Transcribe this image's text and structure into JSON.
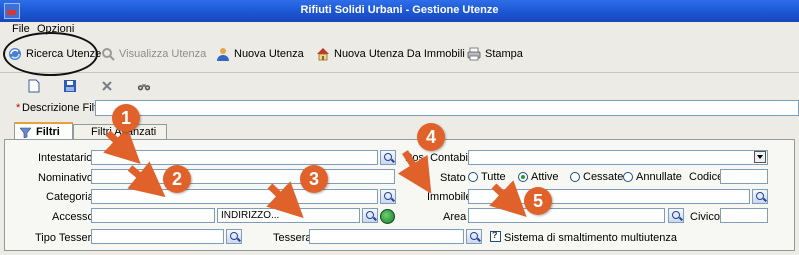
{
  "window": {
    "title": "Rifiuti Solidi Urbani - Gestione Utenze"
  },
  "menu": {
    "items": [
      "File",
      "Opzioni"
    ]
  },
  "toolbar": {
    "ricerca": "Ricerca Utenze",
    "visualizza": "Visualizza Utenza",
    "nuova": "Nuova Utenza",
    "nuova_immobili": "Nuova Utenza Da Immobili",
    "stampa": "Stampa"
  },
  "filter": {
    "descrizione_label": "Descrizione Filtro",
    "descrizione_required_mark": "*",
    "descrizione_value": ""
  },
  "tabs": [
    {
      "label": "Filtri"
    },
    {
      "label": "Filtri Avanzati"
    }
  ],
  "form": {
    "intestatario_label": "Intestatario",
    "intestatario_value": "",
    "nominativo_label": "Nominativo",
    "nominativo_value": "",
    "categoria_label": "Categoria",
    "categoria_value": "",
    "accesso_label": "Accesso",
    "accesso_value": "",
    "indirizzo_value": "INDIRIZZO...",
    "tipo_tessera_label": "Tipo Tessera",
    "tipo_tessera_value": "",
    "tessera_label": "Tessera",
    "tessera_value": "",
    "pos_contabile_label": "Pos. Contabile",
    "pos_contabile_value": "",
    "stato_label": "Stato",
    "stato_options": [
      "Tutte",
      "Attive",
      "Cessate",
      "Annullate"
    ],
    "stato_selected": "Attive",
    "codice_label": "Codice",
    "codice_value": "",
    "immobile_label": "Immobile",
    "immobile_value": "",
    "area_label": "Area",
    "area_value": "",
    "civico_label": "Civico",
    "civico_value": "",
    "sistema_label": "Sistema di smaltimento multiutenza",
    "sistema_checked": false
  },
  "annotations": [
    "1",
    "2",
    "3",
    "4",
    "5"
  ],
  "colors": {
    "titlebar": "#1e5ad9",
    "callout": "#e0622a",
    "window_bg": "#ecebe5"
  }
}
